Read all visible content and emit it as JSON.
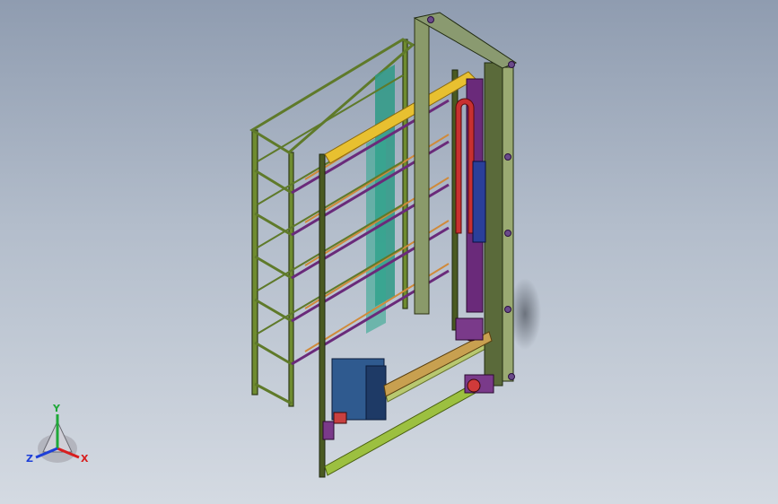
{
  "triad": {
    "x_label": "X",
    "y_label": "Y",
    "z_label": "Z",
    "x_color": "#d81e1e",
    "y_color": "#1ea838",
    "z_color": "#1e3fd8"
  },
  "colors": {
    "frame_green": "#5f7a2a",
    "frame_dark": "#2e3a18",
    "purple": "#6a2a7a",
    "teal_panel": "#2e9a86",
    "yellow_beam": "#e8c030",
    "orange_beam": "#d08a3a",
    "red_pulley": "#c83030",
    "blue_motor": "#2a3f9a",
    "blue_box": "#2f5a8f"
  }
}
